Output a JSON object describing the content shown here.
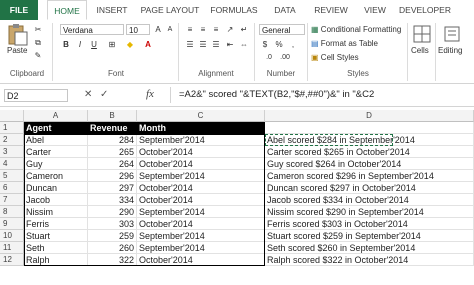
{
  "ribbon": {
    "tabs": [
      "FILE",
      "HOME",
      "INSERT",
      "PAGE LAYOUT",
      "FORMULAS",
      "DATA",
      "REVIEW",
      "VIEW",
      "DEVELOPER"
    ],
    "clipboard": {
      "paste_label": "Paste",
      "group_label": "Clipboard"
    },
    "font": {
      "name": "Verdana",
      "size": "10",
      "group_label": "Font",
      "bold": "B",
      "italic": "I",
      "underline": "U"
    },
    "alignment": {
      "group_label": "Alignment"
    },
    "number": {
      "format": "General",
      "currency": "$",
      "percent": "%",
      "comma": ",",
      "group_label": "Number"
    },
    "styles": {
      "conditional": "Conditional Formatting",
      "format_table": "Format as Table",
      "cell_styles": "Cell Styles",
      "group_label": "Styles"
    },
    "cells": {
      "label": "Cells"
    },
    "editing": {
      "label": "Editing"
    }
  },
  "formula_bar": {
    "name_box": "D2",
    "cancel": "✕",
    "enter": "✓",
    "fx": "fx",
    "formula": "=A2&\" scored \"&TEXT(B2,\"$#,##0\")&\" in \"&C2"
  },
  "columns": [
    "A",
    "B",
    "C",
    "D"
  ],
  "rows": [
    "1",
    "2",
    "3",
    "4",
    "5",
    "6",
    "7",
    "8",
    "9",
    "10",
    "11",
    "12"
  ],
  "headers": {
    "agent": "Agent",
    "revenue": "Revenue",
    "month": "Month"
  },
  "data": [
    {
      "agent": "Abel",
      "revenue": "284",
      "month": "September'2014",
      "result": "Abel scored $284 in September'2014"
    },
    {
      "agent": "Carter",
      "revenue": "265",
      "month": "October'2014",
      "result": "Carter scored $265 in October'2014"
    },
    {
      "agent": "Guy",
      "revenue": "264",
      "month": "October'2014",
      "result": "Guy scored $264 in October'2014"
    },
    {
      "agent": "Cameron",
      "revenue": "296",
      "month": "September'2014",
      "result": "Cameron scored $296 in September'2014"
    },
    {
      "agent": "Duncan",
      "revenue": "297",
      "month": "October'2014",
      "result": "Duncan scored $297 in October'2014"
    },
    {
      "agent": "Jacob",
      "revenue": "334",
      "month": "October'2014",
      "result": "Jacob scored $334 in October'2014"
    },
    {
      "agent": "Nissim",
      "revenue": "290",
      "month": "September'2014",
      "result": "Nissim scored $290 in September'2014"
    },
    {
      "agent": "Ferris",
      "revenue": "303",
      "month": "October'2014",
      "result": "Ferris scored $303 in October'2014"
    },
    {
      "agent": "Stuart",
      "revenue": "259",
      "month": "September'2014",
      "result": "Stuart scored $259 in September'2014"
    },
    {
      "agent": "Seth",
      "revenue": "260",
      "month": "September'2014",
      "result": "Seth scored $260 in September'2014"
    },
    {
      "agent": "Ralph",
      "revenue": "322",
      "month": "October'2014",
      "result": "Ralph scored $322 in October'2014"
    }
  ],
  "colors": {
    "accent": "#217346"
  }
}
